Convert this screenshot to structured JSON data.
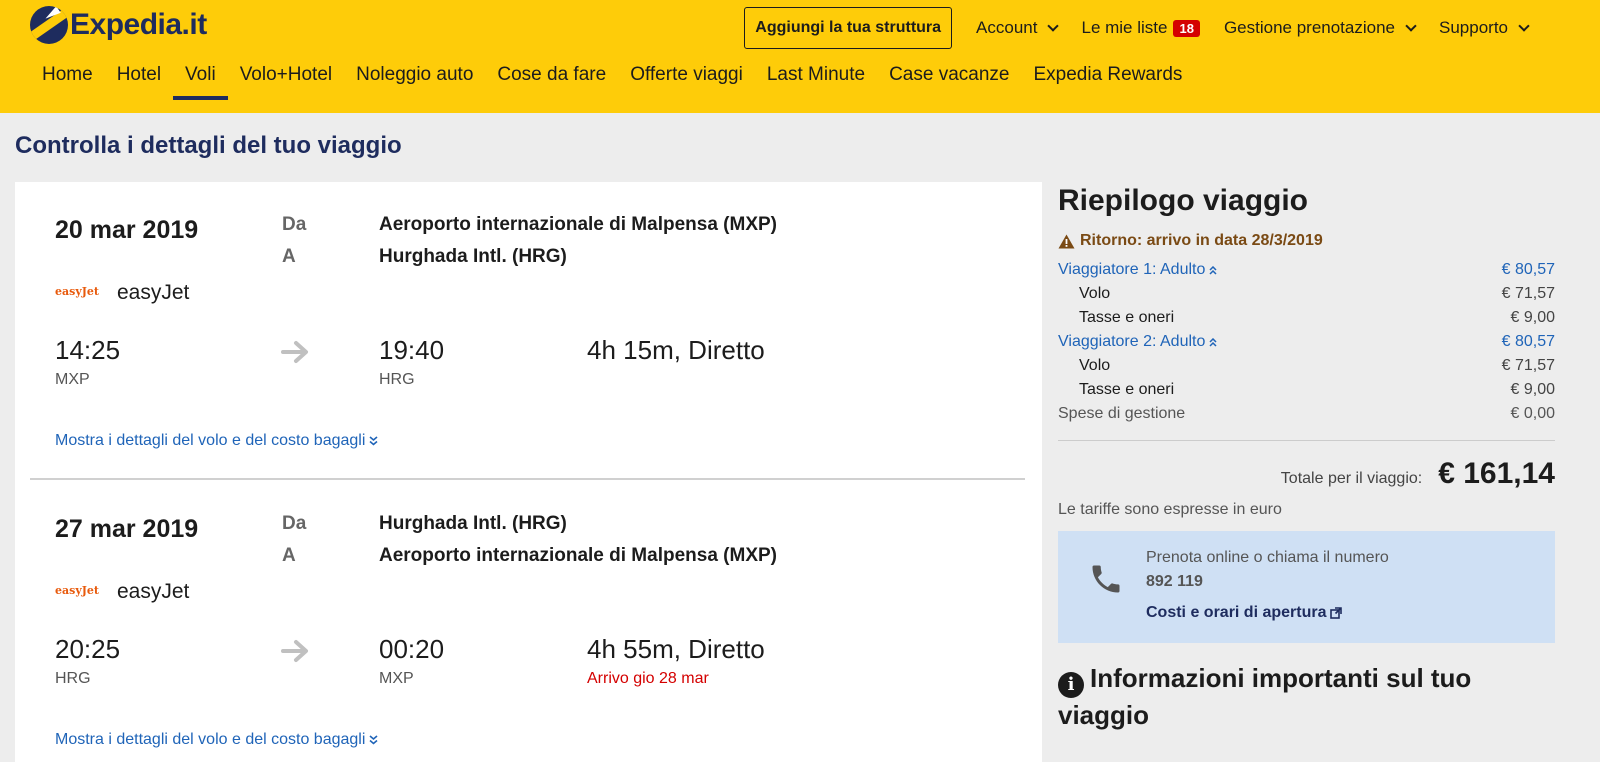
{
  "header": {
    "logo_text": "Expedia.it",
    "add_property": "Aggiungi la tua struttura",
    "account": "Account",
    "my_lists": "Le mie liste",
    "my_lists_count": "18",
    "booking_management": "Gestione prenotazione",
    "support": "Supporto",
    "nav": [
      "Home",
      "Hotel",
      "Voli",
      "Volo+Hotel",
      "Noleggio auto",
      "Cose da fare",
      "Offerte viaggi",
      "Last Minute",
      "Case vacanze",
      "Expedia Rewards"
    ],
    "active_nav": "Voli"
  },
  "page_title": "Controlla i dettagli del tuo viaggio",
  "flights": [
    {
      "date": "20 mar 2019",
      "from_label": "Da",
      "to_label": "A",
      "from_airport": "Aeroporto internazionale di Malpensa (MXP)",
      "to_airport": "Hurghada Intl. (HRG)",
      "airline_logo": "easyJet",
      "airline": "easyJet",
      "dep_time": "14:25",
      "dep_code": "MXP",
      "arr_time": "19:40",
      "arr_code": "HRG",
      "duration": "4h 15m, Diretto",
      "arrival_note": "",
      "details_link": "Mostra i dettagli del volo e del costo bagagli"
    },
    {
      "date": "27 mar 2019",
      "from_label": "Da",
      "to_label": "A",
      "from_airport": "Hurghada Intl. (HRG)",
      "to_airport": "Aeroporto internazionale di Malpensa (MXP)",
      "airline_logo": "easyJet",
      "airline": "easyJet",
      "dep_time": "20:25",
      "dep_code": "HRG",
      "arr_time": "00:20",
      "arr_code": "MXP",
      "duration": "4h 55m, Diretto",
      "arrival_note": "Arrivo gio 28 mar",
      "details_link": "Mostra i dettagli del volo e del costo bagagli"
    }
  ],
  "summary": {
    "title": "Riepilogo viaggio",
    "warning": "Ritorno: arrivo in data 28/3/2019",
    "traveler1": {
      "label": "Viaggiatore 1: Adulto",
      "amount": "€ 80,57"
    },
    "traveler1_flight": {
      "label": "Volo",
      "amount": "€ 71,57"
    },
    "traveler1_taxes": {
      "label": "Tasse e oneri",
      "amount": "€ 9,00"
    },
    "traveler2": {
      "label": "Viaggiatore 2: Adulto",
      "amount": "€ 80,57"
    },
    "traveler2_flight": {
      "label": "Volo",
      "amount": "€ 71,57"
    },
    "traveler2_taxes": {
      "label": "Tasse e oneri",
      "amount": "€ 9,00"
    },
    "fees": {
      "label": "Spese di gestione",
      "amount": "€ 0,00"
    },
    "total_label": "Totale per il viaggio:",
    "total_value": "€ 161,14",
    "currency_note": "Le tariffe sono espresse in euro",
    "call_text": "Prenota online o chiama il numero",
    "call_number": "892 119",
    "call_link": "Costi e orari di apertura",
    "info_title": "Informazioni importanti sul tuo viaggio"
  },
  "colors": {
    "header_bg": "#fecc09",
    "brand_navy": "#1e2c5e",
    "link_blue": "#1f64b8",
    "alert_red": "#d40000",
    "call_box_bg": "#cfe0f4"
  }
}
